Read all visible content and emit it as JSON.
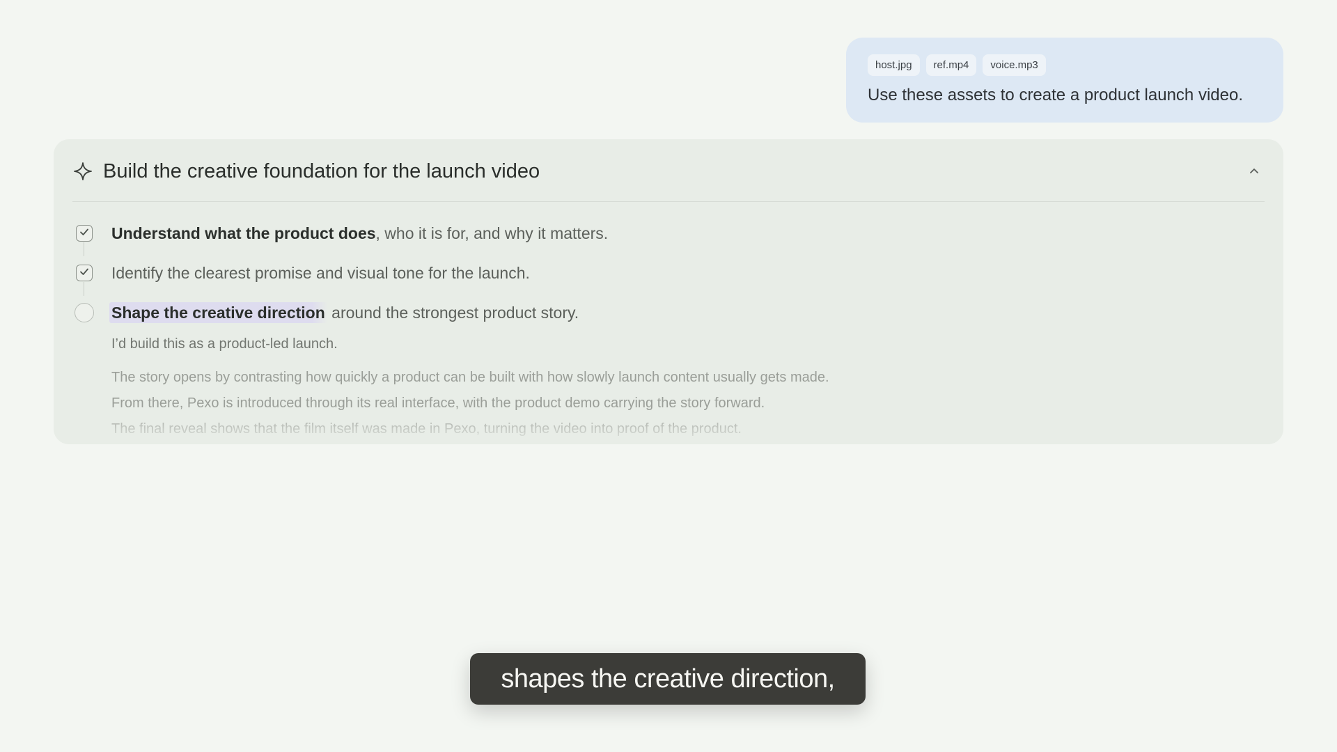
{
  "user_message": {
    "attachments": [
      "host.jpg",
      "ref.mp4",
      "voice.mp3"
    ],
    "text": "Use these assets to create a product launch video."
  },
  "plan": {
    "title": "Build the creative foundation for the launch video",
    "icon": "sparkle-icon",
    "collapse_icon": "chevron-up-icon",
    "steps": [
      {
        "status": "done",
        "bold": "Understand what the product does",
        "rest": ", who it is for, and why it matters."
      },
      {
        "status": "done",
        "bold": "",
        "rest": "Identify the clearest promise and visual tone for the launch."
      },
      {
        "status": "in-progress",
        "bold": "Shape the creative direction",
        "rest": " around the strongest product story."
      }
    ],
    "thinking": {
      "lead": "I’d build this as a product-led launch.",
      "lines": [
        "The story opens by contrasting how quickly a product can be built with how slowly launch content usually gets made.",
        "From there, Pexo is introduced through its real interface, with the product demo carrying the story forward.",
        "The final reveal shows that the film itself was made in Pexo, turning the video into proof of the product."
      ]
    }
  },
  "caption": {
    "text": "shapes the creative direction,"
  },
  "colors": {
    "background": "#f3f6f2",
    "user_bubble": "#dde8f4",
    "card": "#e8ede7",
    "highlight": "#dedcef",
    "caption_bg": "#3c3c38"
  }
}
